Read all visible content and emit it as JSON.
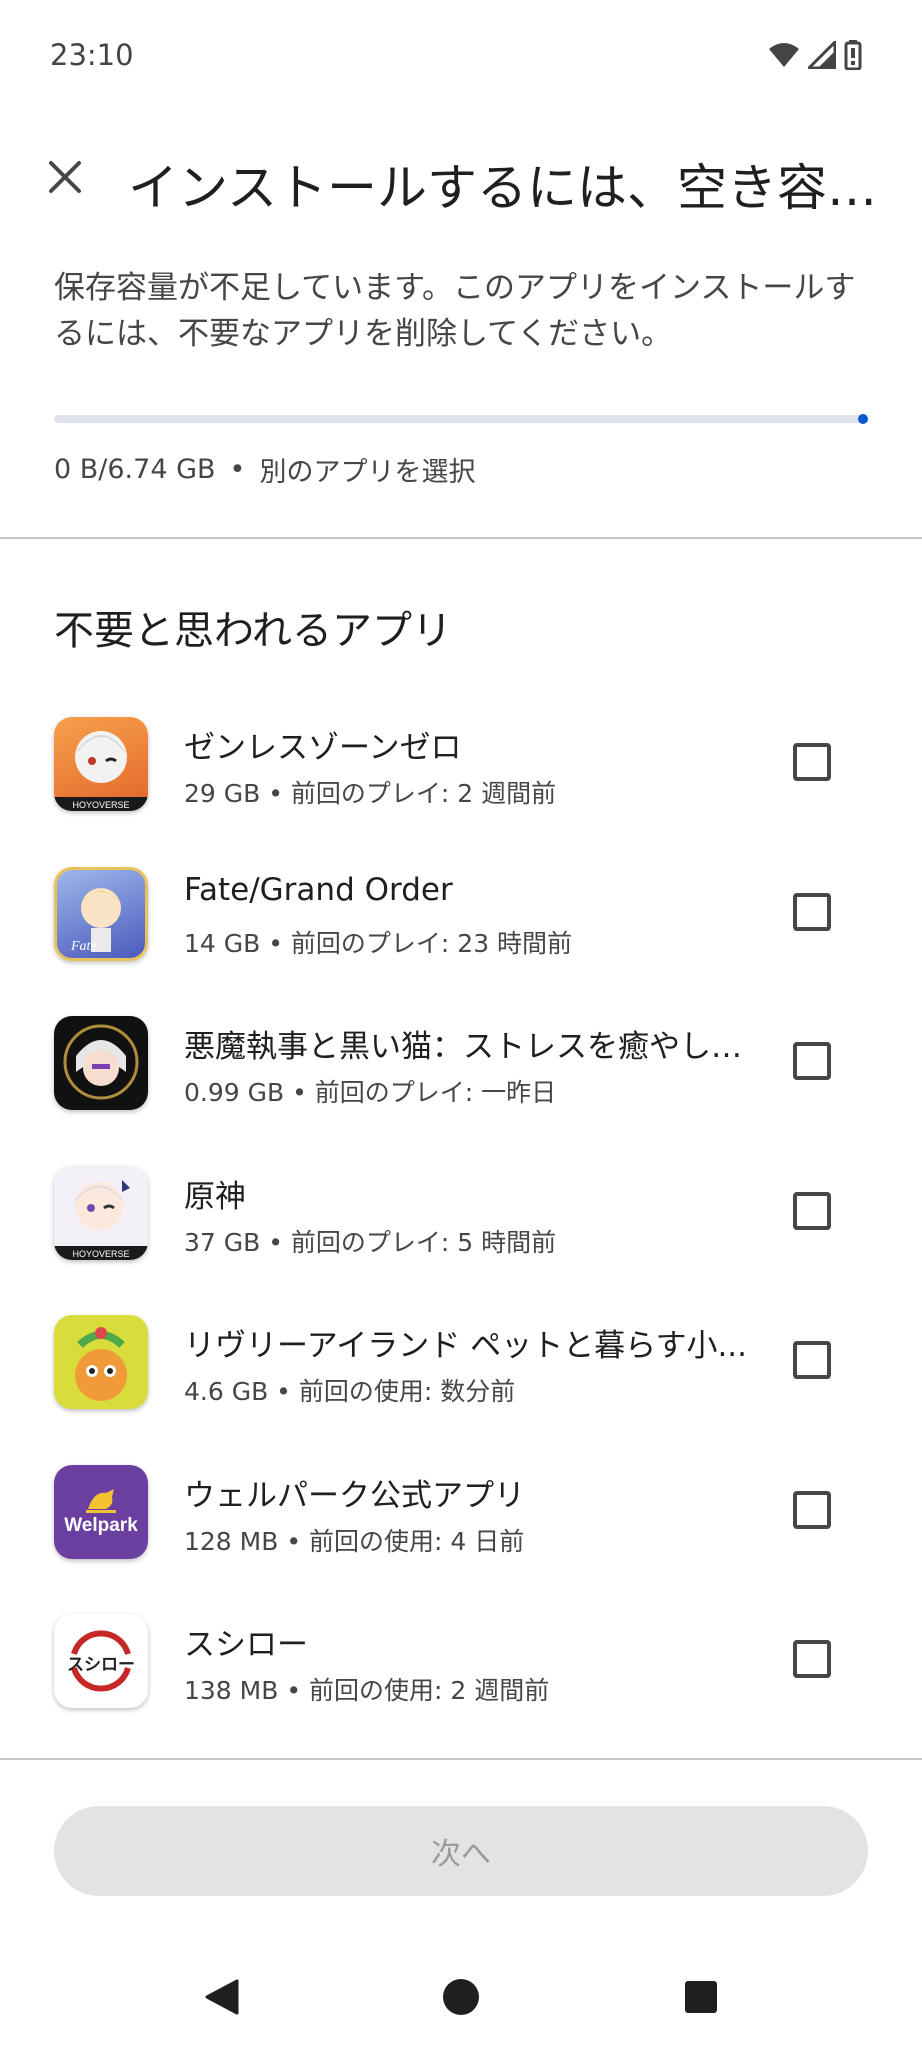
{
  "status_bar": {
    "time": "23:10"
  },
  "header": {
    "title": "インストールするには、空き容量..."
  },
  "description": "保存容量が不足しています。このアプリをインストールするには、不要なアプリを削除してください。",
  "storage": {
    "usage": "0 B/6.74 GB",
    "separator": "•",
    "select_other": "別のアプリを選択",
    "progress_fraction": 1.0
  },
  "section_title": "不要と思われるアプリ",
  "apps": [
    {
      "name": "ゼンレスゾーンゼロ",
      "meta": "29 GB • 前回のプレイ: 2 週間前",
      "icon": "zenless-zone-zero-icon",
      "checked": false,
      "icon_color": "#f28a3c"
    },
    {
      "name": "Fate/Grand Order",
      "meta": "14 GB • 前回のプレイ: 23 時間前",
      "icon": "fate-grand-order-icon",
      "checked": false,
      "icon_color": "#5d6fc9"
    },
    {
      "name": "悪魔執事と黒い猫：ストレスを癒やし、...",
      "meta": "0.99 GB • 前回のプレイ: 一昨日",
      "icon": "akuma-shitsuji-icon",
      "checked": false,
      "icon_color": "#1b1b1b"
    },
    {
      "name": "原神",
      "meta": "37 GB • 前回のプレイ: 5 時間前",
      "icon": "genshin-icon",
      "checked": false,
      "icon_color": "#e9e4f0"
    },
    {
      "name": "リヴリーアイランド ペットと暮らす小...",
      "meta": "4.6 GB • 前回の使用: 数分前",
      "icon": "livly-island-icon",
      "checked": false,
      "icon_color": "#d5d840"
    },
    {
      "name": "ウェルパーク公式アプリ",
      "meta": "128 MB • 前回の使用: 4 日前",
      "icon": "welpark-icon",
      "icon_text": "Welpark",
      "checked": false,
      "icon_color": "#6b3fa0"
    },
    {
      "name": "スシロー",
      "meta": "138 MB • 前回の使用: 2 週間前",
      "icon": "sushiro-icon",
      "icon_text": "スシロー",
      "checked": false,
      "icon_color": "#ffffff"
    }
  ],
  "next_button": {
    "label": "次へ",
    "enabled": false
  },
  "colors": {
    "accent": "#0b57d0",
    "progress_track": "#dfe3eb"
  }
}
